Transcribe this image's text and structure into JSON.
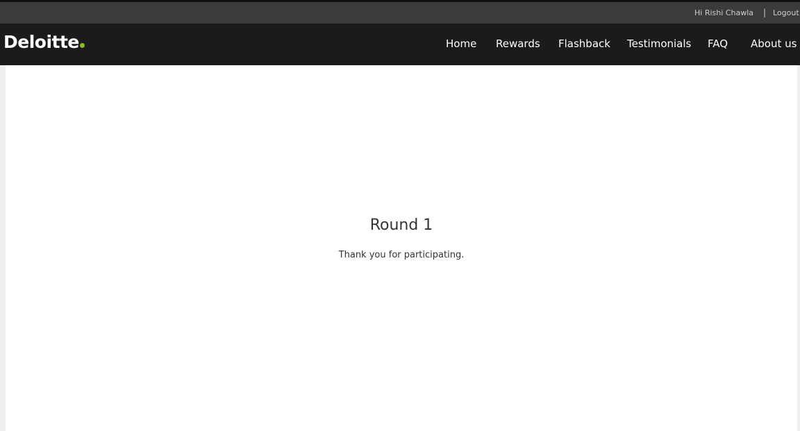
{
  "header": {
    "greeting": "Hi Rishi Chawla",
    "separator": "|",
    "logout_label": "Logout"
  },
  "brand": {
    "name": "Deloitte",
    "accent_color": "#86bc25"
  },
  "nav": {
    "items": [
      "Home",
      "Rewards",
      "Flashback",
      "Testimonials",
      "FAQ",
      "About us"
    ]
  },
  "main": {
    "title": "Round 1",
    "message": "Thank you for participating."
  }
}
